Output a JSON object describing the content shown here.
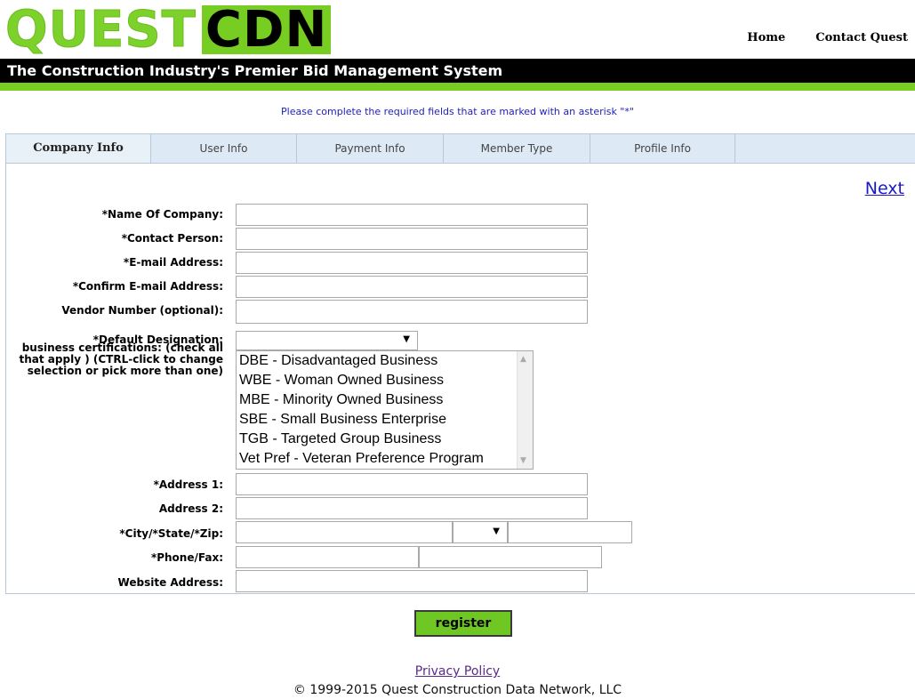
{
  "logo": {
    "part1": "QUEST",
    "part2": "CDN"
  },
  "topnav": {
    "home": "Home",
    "contact": "Contact Quest"
  },
  "banner": "The Construction Industry's Premier Bid Management System",
  "notice": "Please complete the required fields that are marked with an asterisk \"*\"",
  "tabs": [
    "Company Info",
    "User Info",
    "Payment Info",
    "Member Type",
    "Profile Info"
  ],
  "next_label": "Next",
  "fields": {
    "company_name": "*Name Of Company:",
    "contact_person": "*Contact Person:",
    "email": "*E-mail Address:",
    "confirm_email": "*Confirm E-mail Address:",
    "vendor_number": "Vendor Number (optional):",
    "default_designation": "*Default Designation:",
    "certifications": "business certifications: (check all that apply ) (CTRL-click to change selection or pick more than one)",
    "address1": "*Address 1:",
    "address2": "Address 2:",
    "city_state_zip": "*City/*State/*Zip:",
    "phone_fax": "*Phone/Fax:",
    "website": "Website Address:"
  },
  "certification_options": [
    "DBE - Disadvantaged Business",
    "WBE - Woman Owned Business",
    "MBE - Minority Owned Business",
    "SBE - Small Business Enterprise",
    "TGB - Targeted Group Business",
    "Vet Pref - Veteran Preference Program"
  ],
  "register_label": "register",
  "footer": {
    "privacy": "Privacy Policy",
    "copyright": "© 1999-2015 Quest Construction Data Network, LLC"
  }
}
